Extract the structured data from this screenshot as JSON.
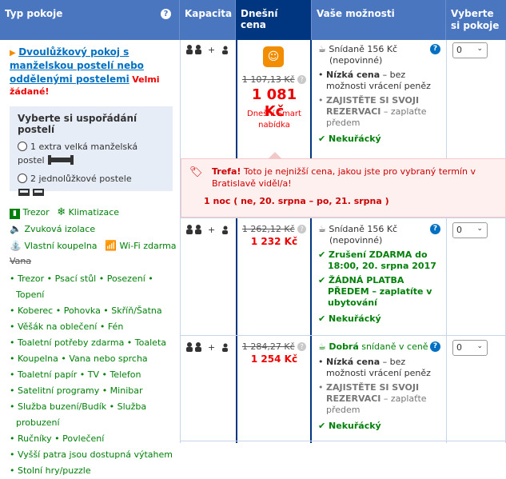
{
  "header": {
    "room_type": "Typ pokoje",
    "capacity": "Kapacita",
    "today_price": "Dnešní cena",
    "your_options": "Vaše možnosti",
    "select_rooms": "Vyberte si pokoje",
    "help_icon": "?"
  },
  "room": {
    "name": "Dvoulůžkový pokoj s manželskou postelí nebo oddělenými postelemi",
    "badge": "Velmi žádané!",
    "bed_box": {
      "title": "Vyberte si uspořádání postelí",
      "option1": "1 extra velká manželská postel",
      "option2": "2 jednolůžkové postele"
    },
    "facilities_top": [
      "Trezor",
      "Klimatizace",
      "Zvuková izolace",
      "Vlastní koupelna",
      "Wi-Fi zdarma"
    ],
    "facility_struck": "Vana",
    "facilities_list": [
      "Trezor • Psací stůl • Posezení • Topení",
      "Koberec • Pohovka • Skříň/Šatna",
      "Věšák na oblečení • Fén",
      "Toaletní potřeby zdarma • Toaleta",
      "Koupelna • Vana nebo sprcha",
      "Toaletní papír • TV • Telefon",
      "Satelitní programy • Minibar",
      "Služba buzení/Budík • Služba probuzení",
      "Ručníky • Povlečení",
      "Vyšší patra jsou dostupná výtahem",
      "Stolní hry/puzzle"
    ]
  },
  "offers": [
    {
      "old_price": "1 107,13 Kč",
      "new_price": "1 081 Kč",
      "deal": "Dnešní Smart nabídka",
      "breakfast": "Snídaně 156 Kč",
      "breakfast_note": "(nepovinné)",
      "opt1_bold": "Nízká cena",
      "opt1_rest": " – bez možnosti vrácení peněz",
      "opt2": "ZAJISTĚTE SI SVOJI REZERVACI",
      "opt2_rest": " – zaplaťte předem",
      "smoking": "Nekuřácký",
      "select_value": "0"
    },
    {
      "old_price": "1 262,12 Kč",
      "new_price": "1 232 Kč",
      "breakfast": "Snídaně 156 Kč",
      "breakfast_note": "(nepovinné)",
      "opt1": "Zrušení ZDARMA do 18:00, 20. srpna 2017",
      "opt2": "ŽÁDNÁ PLATBA PŘEDEM",
      "opt2_rest": " – zaplatíte v ubytování",
      "smoking": "Nekuřácký",
      "select_value": "0"
    },
    {
      "old_price": "1 284,27 Kč",
      "new_price": "1 254 Kč",
      "breakfast_bold": "Dobrá",
      "breakfast": " snídaně v ceně",
      "opt1_bold": "Nízká cena",
      "opt1_rest": " – bez možnosti vrácení peněz",
      "opt2": "ZAJISTĚTE SI SVOJI REZERVACI",
      "opt2_rest": " – zaplaťte předem",
      "smoking": "Nekuřácký",
      "select_value": "0"
    }
  ],
  "tooltip": {
    "bold": "Trefa!",
    "text": " Toto je nejnižší cena, jakou jste pro vybraný termín v Bratislavě viděl/a!",
    "dates": "1 noc ( ne, 20. srpna – po, 21. srpna )"
  },
  "colors": {
    "header": "#4a76c0",
    "header_today": "#003580",
    "link": "#0071c2",
    "price_red": "#e00000",
    "green": "#008009"
  }
}
